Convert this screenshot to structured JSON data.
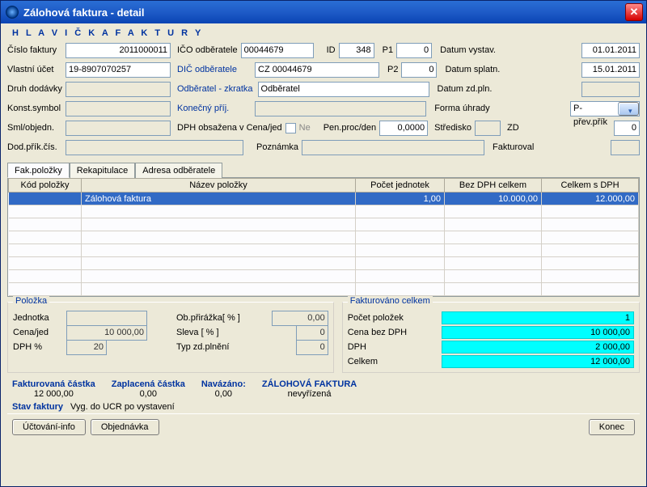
{
  "window": {
    "title": "Zálohová faktura - detail"
  },
  "section": "H L A V I Č K A   F A K T U R Y",
  "labels": {
    "cislo_faktury": "Číslo faktury",
    "ico_odberatele": "IČO odběratele",
    "id": "ID",
    "p1": "P1",
    "p2": "P2",
    "datum_vystav": "Datum vystav.",
    "vlastni_ucet": "Vlastní účet",
    "dic_odberatele": "DIČ odběratele",
    "datum_splatn": "Datum splatn.",
    "druh_dodavky": "Druh dodávky",
    "odberatel_zkratka": "Odběratel - zkratka",
    "datum_zdpln": "Datum zd.pln.",
    "konst_symbol": "Konst.symbol",
    "konecny_prij": "Konečný příj.",
    "forma_uhrady": "Forma úhrady",
    "sml_objed": "Sml/objedn.",
    "dph_obsazena": "DPH obsažena v Cena/jed",
    "ne": "Ne",
    "pen_proc_den": "Pen.proc/den",
    "stredisko": "Středisko",
    "zd": "ZD",
    "dod_prik_cis": "Dod.přík.čís.",
    "poznamka": "Poznámka",
    "fakturoval": "Fakturoval"
  },
  "header": {
    "cislo_faktury": "2011000011",
    "ico_odberatele": "00044679",
    "id": "348",
    "p1": "0",
    "datum_vystav": "01.01.2011",
    "vlastni_ucet": "19-8907070257",
    "dic_odberatele": "CZ 00044679",
    "p2": "0",
    "datum_splatn": "15.01.2011",
    "druh_dodavky": "",
    "odberatel_zkratka": "Odběratel",
    "datum_zdpln": "",
    "konst_symbol": "",
    "konecny_prij": "",
    "forma_uhrady": "P-přev.přík",
    "sml_objed": "",
    "pen_proc_den": "0,0000",
    "stredisko": "",
    "zd": "0",
    "dod_prik_cis": "",
    "poznamka": "",
    "fakturoval": ""
  },
  "tabs": {
    "items": [
      "Fak.položky",
      "Rekapitulace",
      "Adresa odběratele"
    ]
  },
  "table": {
    "headers": {
      "kod": "Kód položky",
      "nazev": "Název položky",
      "pocet": "Počet jednotek",
      "bezdph": "Bez DPH celkem",
      "sdph": "Celkem s DPH"
    },
    "rows": [
      {
        "kod": "",
        "nazev": "Zálohová faktura",
        "pocet": "1,00",
        "bezdph": "10.000,00",
        "sdph": "12.000,00"
      }
    ]
  },
  "polozka": {
    "legend": "Položka",
    "jednotka_l": "Jednotka",
    "jednotka": "",
    "ob_prirazka_l": "Ob.přirážka[ % ]",
    "ob_prirazka": "0,00",
    "cena_jed_l": "Cena/jed",
    "cena_jed": "10 000,00",
    "sleva_l": "Sleva [ % ]",
    "sleva": "0",
    "dph_l": "DPH %",
    "dph": "20",
    "typ_l": "Typ zd.plnění",
    "typ": "0"
  },
  "fakt_celkem": {
    "legend": "Fakturováno celkem",
    "pocet_l": "Počet položek",
    "pocet": "1",
    "cena_bez_l": "Cena bez DPH",
    "cena_bez": "10 000,00",
    "dph_l": "DPH",
    "dph": "2 000,00",
    "celkem_l": "Celkem",
    "celkem": "12 000,00"
  },
  "summary": {
    "fakt_castka_l": "Fakturovaná částka",
    "fakt_castka": "12 000,00",
    "zapl_castka_l": "Zaplacená částka",
    "zapl_castka": "0,00",
    "navazano_l": "Navázáno:",
    "navazano": "0,00",
    "zaloh_l": "ZÁLOHOVÁ FAKTURA",
    "zaloh_v": "nevyřízená"
  },
  "status": {
    "label": "Stav faktury",
    "value": "Vyg. do UCR po vystavení"
  },
  "buttons": {
    "uctovani": "Účtování-info",
    "objednavka": "Objednávka",
    "konec": "Konec"
  }
}
